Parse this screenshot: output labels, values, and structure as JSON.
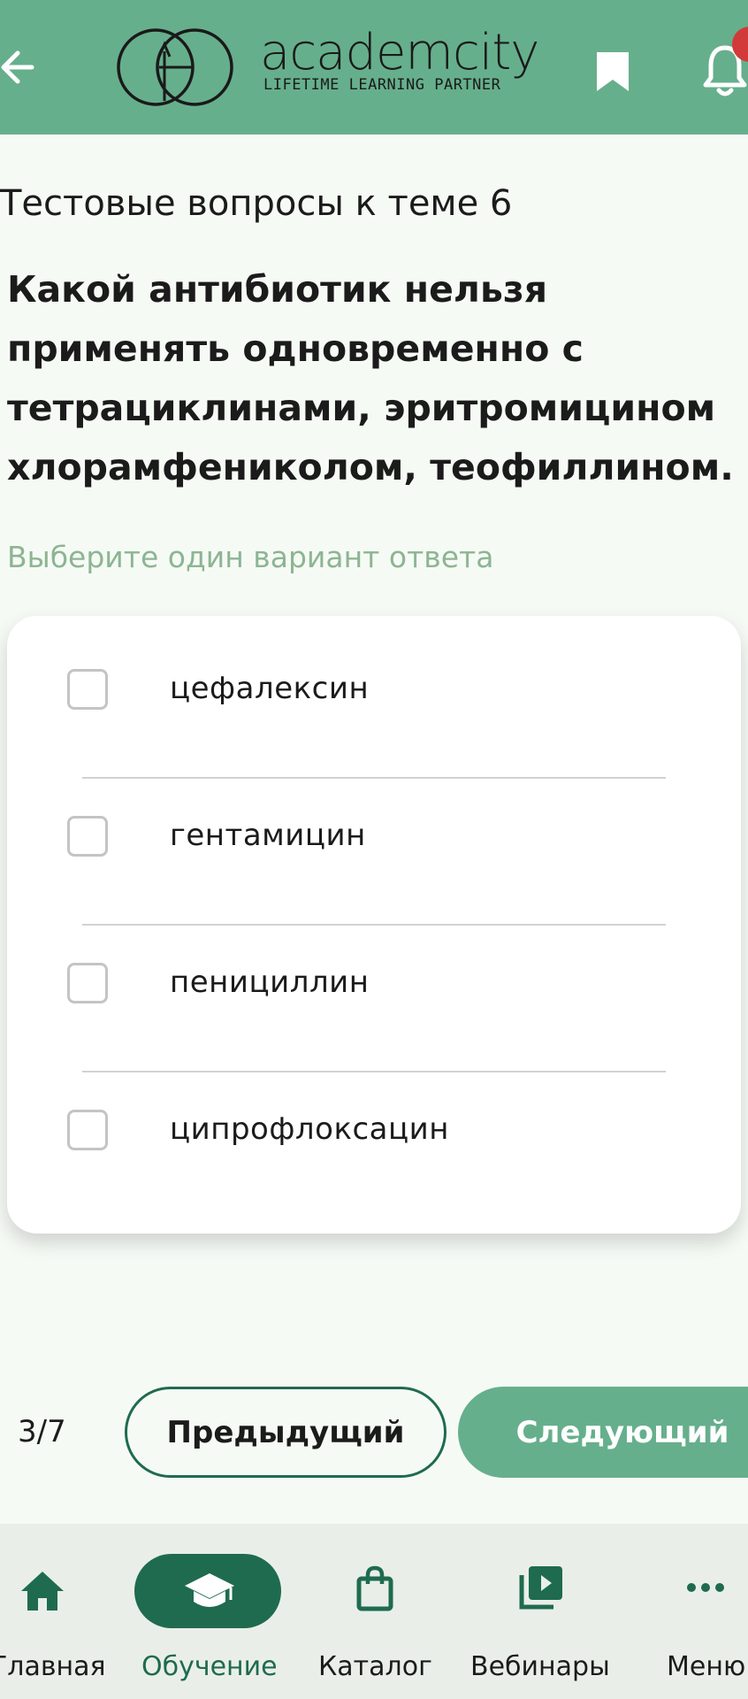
{
  "header": {
    "logo_word": "academcity",
    "logo_tagline": "LIFETIME LEARNING PARTNER",
    "icons": [
      "arrow-left-icon",
      "bookmark-icon",
      "bell-icon"
    ],
    "notification_badge_color": "#d23a3a",
    "background_color": "#66af8c"
  },
  "content": {
    "topic_title": "Тестовые вопросы к теме 6",
    "question": "Какой антибиотик нельзя применять одновременно с тетрациклинами, эритромицином хлорамфениколом, теофиллином.",
    "hint": "Выберите один вариант ответа",
    "options": [
      {
        "label": "цефалексин",
        "checked": false
      },
      {
        "label": "гентамицин",
        "checked": false
      },
      {
        "label": "пенициллин",
        "checked": false
      },
      {
        "label": "ципрофлоксацин",
        "checked": false
      }
    ]
  },
  "pagination": {
    "counter": "3/7",
    "prev_label": "Предыдущий",
    "next_label": "Следующий"
  },
  "bottom_nav": {
    "items": [
      {
        "label": "Главная",
        "icon": "home-icon",
        "active": false
      },
      {
        "label": "Обучение",
        "icon": "graduation-cap-icon",
        "active": true
      },
      {
        "label": "Каталог",
        "icon": "shopping-bag-icon",
        "active": false
      },
      {
        "label": "Вебинары",
        "icon": "video-library-icon",
        "active": false
      },
      {
        "label": "Меню",
        "icon": "more-dots-icon",
        "active": false
      }
    ],
    "active_color": "#1f6b4f"
  }
}
